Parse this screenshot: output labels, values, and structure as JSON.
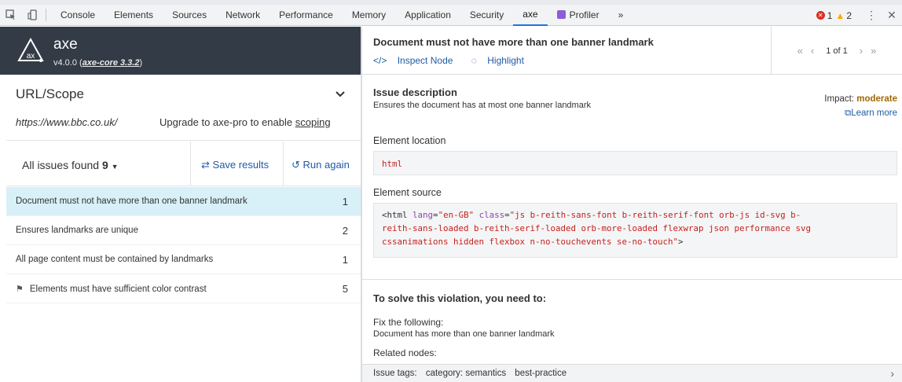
{
  "devtools": {
    "tabs": [
      "Console",
      "Elements",
      "Sources",
      "Network",
      "Performance",
      "Memory",
      "Application",
      "Security",
      "axe",
      "Profiler"
    ],
    "active_tab": "axe",
    "more": "»",
    "error_count": "1",
    "warning_count": "2",
    "kebab": "⋮",
    "close": "✕"
  },
  "axe": {
    "name": "axe",
    "version_prefix": "v4.0.0 (",
    "core_version": "axe-core 3.3.2",
    "version_suffix": ")"
  },
  "scope": {
    "title": "URL/Scope",
    "url": "https://www.bbc.co.uk/",
    "upgrade_prefix": "Upgrade to axe-pro to enable ",
    "upgrade_link": "scoping"
  },
  "issues_bar": {
    "all_issues": "All issues",
    "found": "found",
    "count": "9",
    "save": "Save results",
    "run": "Run again"
  },
  "issues": [
    {
      "label": "Document must not have more than one banner landmark",
      "count": "1"
    },
    {
      "label": "Ensures landmarks are unique",
      "count": "2"
    },
    {
      "label": "All page content must be contained by landmarks",
      "count": "1"
    },
    {
      "label": "Elements must have sufficient color contrast",
      "count": "5"
    }
  ],
  "detail": {
    "title": "Document must not have more than one banner landmark",
    "inspect": "Inspect Node",
    "highlight": "Highlight",
    "pager": "1 of 1",
    "description_title": "Issue description",
    "description": "Ensures the document has at most one banner landmark",
    "impact_label": "Impact:",
    "impact_value": "moderate",
    "learn_more": "Learn more",
    "location_label": "Element location",
    "location": "html",
    "source_label": "Element source",
    "source_tag": "<html",
    "source_attr1": "lang",
    "source_val1": "\"en-GB\"",
    "source_attr2": "class",
    "source_val2_line1": "\"js b-reith-sans-font b-reith-serif-font orb-js id-svg b-",
    "source_val2_line2": "reith-sans-loaded b-reith-serif-loaded orb-more-loaded flexwrap json performance svg",
    "source_val2_line3": "cssanimations hidden flexbox n-no-touchevents se-no-touch\"",
    "source_close": ">",
    "solve_title": "To solve this violation, you need to:",
    "fix_label": "Fix the following:",
    "fix_text": "Document has more than one banner landmark",
    "related": "Related nodes:",
    "tags_label": "Issue tags:",
    "tag1": "category: semantics",
    "tag2": "best-practice"
  }
}
